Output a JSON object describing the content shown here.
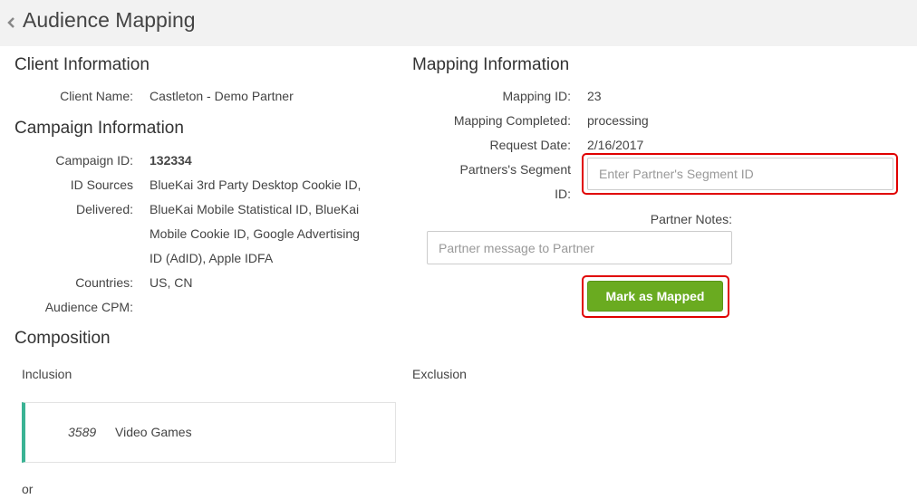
{
  "header": {
    "title": "Audience Mapping"
  },
  "client_info": {
    "title": "Client Information",
    "client_name_label": "Client Name:",
    "client_name": "Castleton - Demo Partner"
  },
  "campaign_info": {
    "title": "Campaign Information",
    "campaign_id_label": "Campaign ID:",
    "campaign_id": "132334",
    "id_sources_label_1": "ID Sources",
    "id_sources_label_2": "Delivered:",
    "id_sources_lines": [
      "BlueKai 3rd Party Desktop Cookie ID,",
      "BlueKai Mobile Statistical ID, BlueKai",
      "Mobile Cookie ID, Google Advertising",
      "ID (AdID), Apple IDFA"
    ],
    "countries_label": "Countries:",
    "countries": "US, CN",
    "audience_cpm_label": "Audience CPM:"
  },
  "mapping_info": {
    "title": "Mapping Information",
    "mapping_id_label": "Mapping ID:",
    "mapping_id": "23",
    "mapping_completed_label": "Mapping Completed:",
    "mapping_completed": "processing",
    "request_date_label": "Request Date:",
    "request_date": "2/16/2017",
    "segment_label_1": "Partners's Segment",
    "segment_label_2": "ID:",
    "segment_placeholder": "Enter Partner's Segment ID",
    "notes_label": "Partner Notes:",
    "notes_placeholder": "Partner message to Partner",
    "mark_button": "Mark as Mapped"
  },
  "composition": {
    "title": "Composition",
    "inclusion_label": "Inclusion",
    "exclusion_label": "Exclusion",
    "inclusion_items": [
      {
        "id": "3589",
        "name": "Video Games"
      }
    ],
    "or_label": "or"
  },
  "colors": {
    "header_bg": "#f2f2f2",
    "button_green": "#6aab20",
    "highlight_red": "#e00000",
    "card_accent": "#3ab394"
  },
  "icons": {
    "back": "chevron-left-icon"
  }
}
